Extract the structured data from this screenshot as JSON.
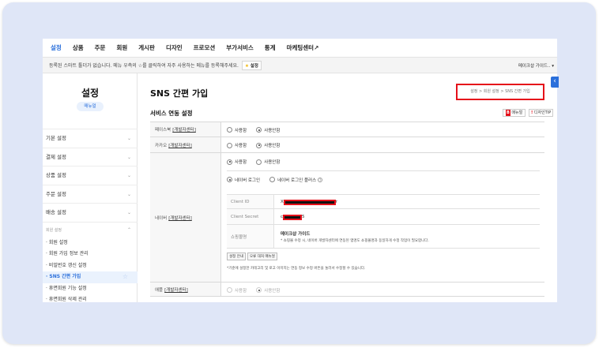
{
  "topnav": [
    "설정",
    "상품",
    "주문",
    "회원",
    "게시판",
    "디자인",
    "프로모션",
    "부가서비스",
    "통계",
    "마케팅센터↗"
  ],
  "notice": {
    "message": "등록된 스마트 툴더가 없습니다. 메뉴 우측의 ☆를 클릭하여 자주 사용하는 메뉴를 등록해주세요.",
    "set_button": "설정",
    "guide": "메이크샵 가이드.. ▾"
  },
  "sidebar": {
    "title": "설정",
    "manual": "매뉴얼",
    "items": [
      "기본 설정",
      "결제 설정",
      "상품 설정",
      "주문 설정",
      "배송 설정"
    ],
    "group_title": "회원 설정",
    "subitems": [
      "· 회원 설정",
      "· 회원 가입 정보 관리",
      "· 비밀번호 갱신 설정",
      "· SNS 간편 가입",
      "· 휴면회원 기능 설정",
      "· 휴면회원 삭제 관리"
    ]
  },
  "content": {
    "page_title": "SNS 간편 가입",
    "breadcrumb": "설정 > 회원 설정 > SNS 간편 가입",
    "section_title": "서비스 연동 설정",
    "btn_manual": "매뉴얼",
    "btn_tip": "디자인TIP",
    "facebook_label": "페이스북",
    "facebook_link": "[개발자센터]",
    "kakao_label": "카카오",
    "kakao_link": "[개발자센터]",
    "naver_label": "네이버",
    "naver_link": "[개발자센터]",
    "apple_label": "애플",
    "apple_link": "[개발자센터]",
    "opt_use": "사용함",
    "opt_nouse": "사용안함",
    "naver_login": "네이버 로그인",
    "naver_login_plus": "네이버 로그인 플러스",
    "client_id_label": "Client ID",
    "client_id_suffix": "r",
    "client_secret_label": "Client Secret",
    "client_secret_prefix": "c",
    "client_secret_suffix": "5",
    "shop_name_label": "쇼핑몰명",
    "shop_name": "메이크샵 가이드",
    "shop_note": "* 쇼핑몰 수정 시, 네이버 개발자센터에 연동된 앱명도 쇼핑몰명과 동일하게 수정 작업이 필요합니다.",
    "btn_setup": "설정 안내",
    "btn_error": "오류 대처 매뉴얼",
    "footnote": "*기준에 설정한 카테고리 및 로고 이미지는 연동 정보 수정 버튼을 눌러서 수정할 수 있습니다."
  }
}
